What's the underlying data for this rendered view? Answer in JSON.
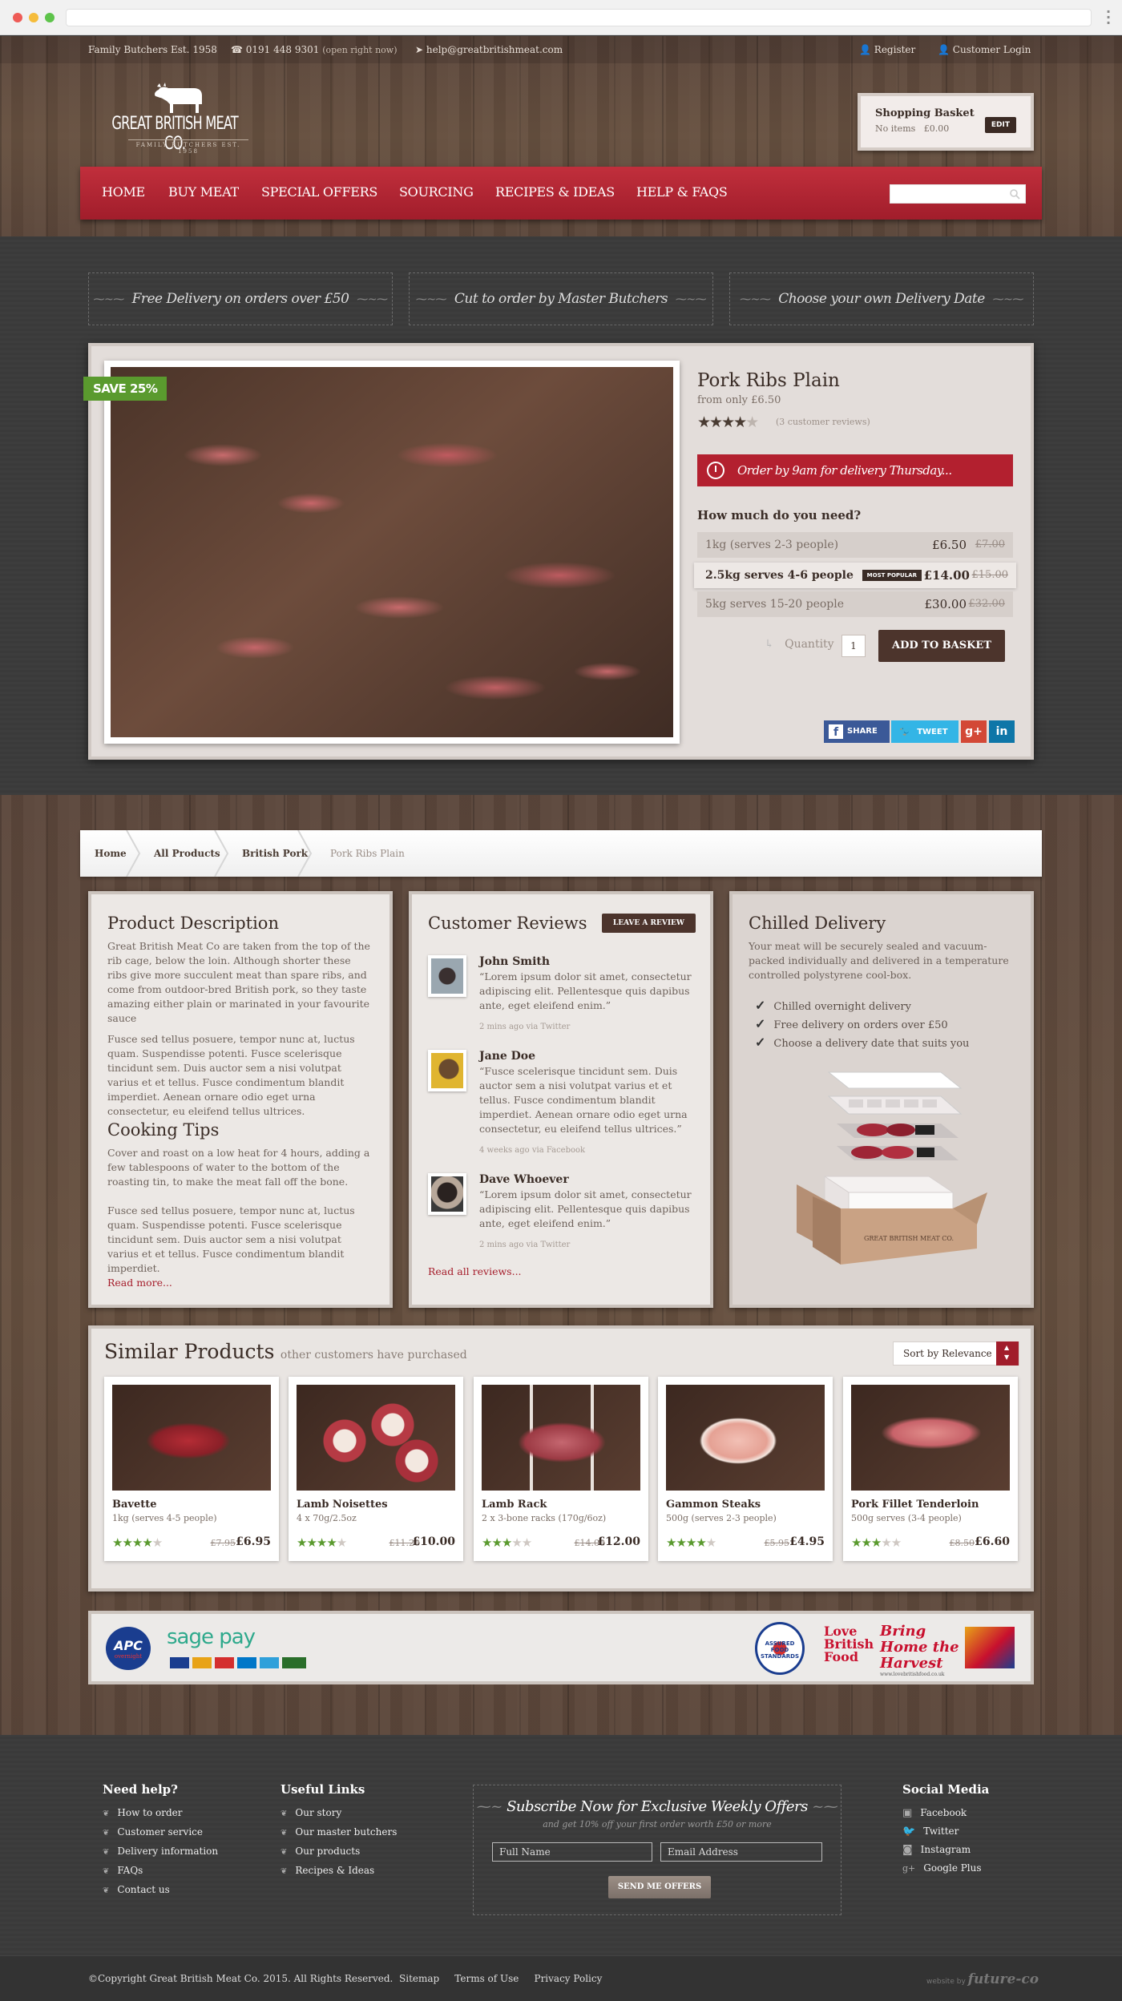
{
  "colors": {
    "accent_red": "#a11d2b",
    "save_green": "#5a9a2e",
    "wood": "#5f4a3c",
    "dark": "#3a3a3a"
  },
  "topbar": {
    "tagline": "Family Butchers Est. 1958",
    "phone": "0191 448 9301",
    "phone_note": "(open right now)",
    "email": "help@greatbritishmeat.com",
    "register": "Register",
    "login": "Customer Login"
  },
  "logo": {
    "name": "GREAT BRITISH MEAT CO.",
    "sub": "FAMILY BUTCHERS EST. 1958"
  },
  "basket": {
    "title": "Shopping Basket",
    "items": "No items",
    "total": "£0.00",
    "edit": "EDIT"
  },
  "nav": {
    "items": [
      "HOME",
      "BUY MEAT",
      "SPECIAL OFFERS",
      "SOURCING",
      "RECIPES & IDEAS",
      "HELP & FAQS"
    ],
    "search_placeholder": ""
  },
  "usps": [
    "Free Delivery on orders over £50",
    "Cut to order by Master Butchers",
    "Choose your own Delivery Date"
  ],
  "product": {
    "badge": "SAVE 25%",
    "title": "Pork Ribs Plain",
    "from": "from only £6.50",
    "rating": 4,
    "rating_max": 5,
    "reviews": "(3 customer reviews)",
    "order_note": "Order by 9am for delivery Thursday...",
    "question": "How much do you need?",
    "options": [
      {
        "label": "1kg (serves 2-3 people)",
        "price": "£6.50",
        "old": "£7.00",
        "popular": ""
      },
      {
        "label": "2.5kg serves 4-6 people",
        "price": "£14.00",
        "old": "£15.00",
        "popular": "MOST POPULAR"
      },
      {
        "label": "5kg serves 15-20 people",
        "price": "£30.00",
        "old": "£32.00",
        "popular": ""
      }
    ],
    "quantity_label": "Quantity",
    "quantity": "1",
    "add": "ADD TO BASKET",
    "share": {
      "facebook": "SHARE",
      "twitter": "TWEET",
      "gplus": "g+",
      "linkedin": "in"
    }
  },
  "breadcrumbs": [
    "Home",
    "All Products",
    "British Pork",
    "Pork Ribs Plain"
  ],
  "description": {
    "title": "Product Description",
    "p1": "Great British Meat Co are taken from the top of the rib cage, below the loin. Although shorter these ribs give more succulent meat than spare ribs, and come from outdoor-bred British pork, so they taste amazing either plain or marinated in your favourite sauce",
    "p2": "Fusce sed tellus posuere, tempor nunc at, luctus quam. Suspendisse potenti. Fusce scelerisque tincidunt sem. Duis auctor sem a nisi volutpat varius et et tellus. Fusce condimentum blandit imperdiet. Aenean ornare odio eget urna consectetur, eu eleifend tellus ultrices.",
    "tips_title": "Cooking Tips",
    "p3": "Cover and roast on a low heat for 4 hours, adding a few tablespoons of water to the bottom of the roasting tin, to make the meat fall off the bone.",
    "p4": "Fusce sed tellus posuere, tempor nunc at, luctus quam. Suspendisse potenti. Fusce scelerisque tincidunt sem. Duis auctor sem a nisi volutpat varius et et tellus. Fusce condimentum blandit imperdiet.",
    "more": "Read more..."
  },
  "reviews": {
    "title": "Customer Reviews",
    "leave": "LEAVE A REVIEW",
    "all": "Read all reviews...",
    "items": [
      {
        "name": "John Smith",
        "text": "“Lorem ipsum dolor sit amet, consectetur adipiscing elit. Pellentesque quis dapibus ante, eget eleifend enim.”",
        "meta": "2 mins ago via Twitter"
      },
      {
        "name": "Jane Doe",
        "text": "“Fusce scelerisque tincidunt sem. Duis auctor sem a nisi volutpat varius et et tellus. Fusce condimentum blandit imperdiet. Aenean ornare odio eget urna consectetur, eu eleifend tellus ultrices.”",
        "meta": "4 weeks ago via Facebook"
      },
      {
        "name": "Dave Whoever",
        "text": "“Lorem ipsum dolor sit amet, consectetur adipiscing elit. Pellentesque quis dapibus ante, eget eleifend enim.”",
        "meta": "2 mins ago via Twitter"
      }
    ]
  },
  "delivery": {
    "title": "Chilled Delivery",
    "text": "Your meat will be securely sealed and vacuum-packed individually and delivered in a temperature controlled polystyrene cool-box.",
    "points": [
      "Chilled overnight delivery",
      "Free delivery on orders over £50",
      "Choose a delivery date that suits you"
    ],
    "box_label": "GREAT BRITISH MEAT CO."
  },
  "similar": {
    "title": "Similar Products",
    "subtitle": "other customers have purchased",
    "sort": "Sort by Relevance",
    "items": [
      {
        "name": "Bavette",
        "desc": "1kg (serves 4-5 people)",
        "rating": 4,
        "old": "£7.95",
        "price": "£6.95"
      },
      {
        "name": "Lamb Noisettes",
        "desc": "4 x 70g/2.5oz",
        "rating": 4,
        "old": "£11.20",
        "price": "£10.00"
      },
      {
        "name": "Lamb Rack",
        "desc": "2 x 3-bone racks (170g/6oz)",
        "rating": 3,
        "old": "£14.00",
        "price": "£12.00"
      },
      {
        "name": "Gammon Steaks",
        "desc": "500g (serves 2-3 people)",
        "rating": 4,
        "old": "£5.95",
        "price": "£4.95"
      },
      {
        "name": "Pork Fillet Tenderloin",
        "desc": "500g serves (3-4 people)",
        "rating": 3,
        "old": "£8.50",
        "price": "£6.60"
      }
    ]
  },
  "logos": {
    "apc": "APC",
    "apc_sub": "overnight",
    "sagepay": "sage pay",
    "assured": "ASSURED FOOD STANDARDS",
    "love": "Love British Food",
    "bring": "Bring Home the Harvest",
    "bring_url": "www.lovebritishfood.co.uk"
  },
  "footer": {
    "help_title": "Need help?",
    "help": [
      "How to order",
      "Customer service",
      "Delivery information",
      "FAQs",
      "Contact us"
    ],
    "links_title": "Useful Links",
    "links": [
      "Our story",
      "Our master butchers",
      "Our products",
      "Recipes & Ideas"
    ],
    "sub_title": "Subscribe Now for Exclusive Weekly Offers",
    "sub_desc": "and get 10% off your first order worth £50 or more",
    "name_ph": "Full Name",
    "email_ph": "Email Address",
    "send": "SEND ME OFFERS",
    "social_title": "Social Media",
    "social": [
      "Facebook",
      "Twitter",
      "Instagram",
      "Google Plus"
    ],
    "copyright": "©Copyright Great British Meat Co. 2015. All Rights Reserved.",
    "sitemap": "Sitemap",
    "terms": "Terms of Use",
    "privacy": "Privacy Policy",
    "credit_pre": "website by",
    "credit": "future-co"
  }
}
